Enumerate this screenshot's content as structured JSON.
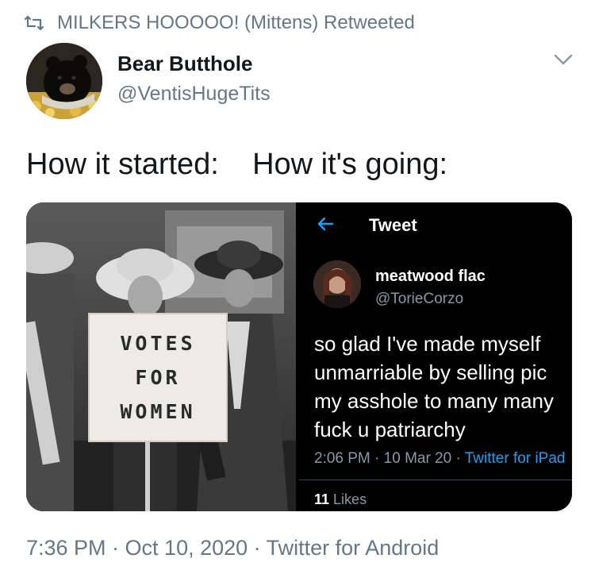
{
  "retweet": {
    "icon": "retweet-icon",
    "text": "MILKERS HOOOOO! (Mittens) Retweeted"
  },
  "author": {
    "display_name": "Bear Butthole",
    "handle": "@VentisHugeTits",
    "avatar_icon": "bear-avatar",
    "menu_icon": "chevron-down-icon"
  },
  "tweet": {
    "text": "How it started:    How it's going:"
  },
  "media": {
    "photo_left": {
      "sign_lines": [
        "VOTES",
        "FOR",
        "WOMEN"
      ]
    },
    "embedded_tweet": {
      "header_title": "Tweet",
      "back_icon": "back-arrow-icon",
      "author_name": "meatwood flac",
      "author_handle": "@TorieCorzo",
      "text": "so glad I've made myself\nunmarriable by selling pic\nmy asshole to many many\nfuck u patriarchy",
      "time": "2:06 PM",
      "date": "10 Mar 20",
      "source": "Twitter for iPad",
      "likes_count": "11",
      "likes_label": "Likes"
    }
  },
  "footer": {
    "timestamp": "7:36 PM · Oct 10, 2020 · Twitter for Android"
  },
  "colors": {
    "secondary_text": "#657786",
    "link_blue": "#1da1f2",
    "dark_bg": "#000000"
  }
}
